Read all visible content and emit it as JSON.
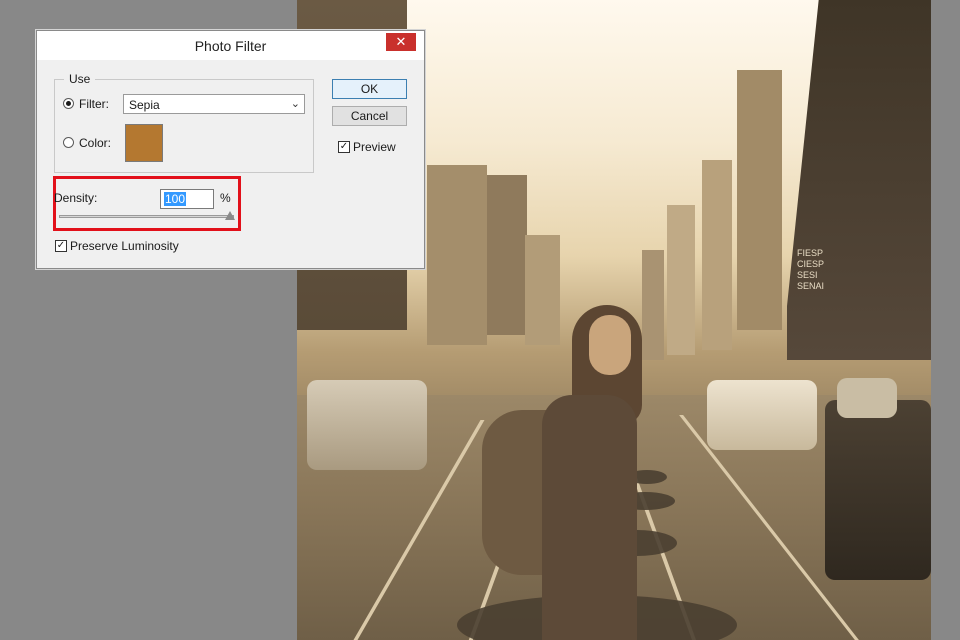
{
  "dialog": {
    "title": "Photo Filter",
    "close_label": "✕",
    "use_group": {
      "legend": "Use",
      "filter_label": "Filter:",
      "filter_selected": true,
      "filter_value": "Sepia",
      "color_label": "Color:",
      "color_selected": false,
      "color_swatch": "#b47830"
    },
    "density": {
      "label": "Density:",
      "value": "100",
      "unit": "%",
      "slider_percent": 100
    },
    "preserve_luminosity": {
      "label": "Preserve Luminosity",
      "checked": true
    },
    "buttons": {
      "ok": "OK",
      "cancel": "Cancel"
    },
    "preview": {
      "label": "Preview",
      "checked": true
    }
  },
  "photo": {
    "sign_text": "FIESP\nCIESP\nSESI\nSENAI"
  },
  "colors": {
    "highlight": "#e2101a",
    "sepia_swatch": "#b47830",
    "workspace": "#888888"
  }
}
